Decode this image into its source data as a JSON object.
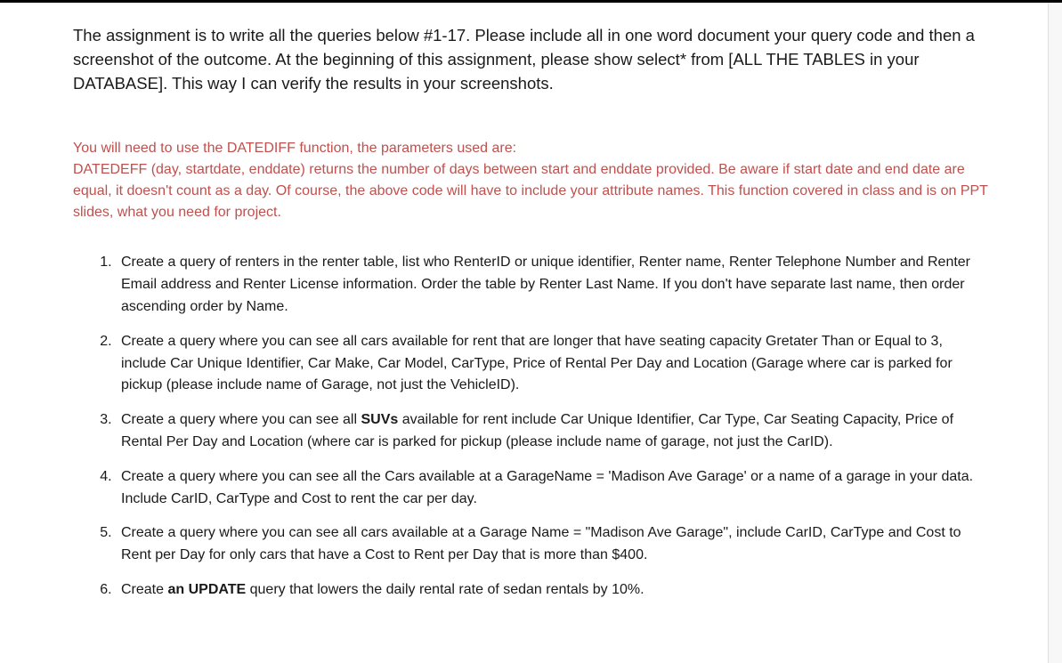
{
  "intro": "The assignment is to write all the queries below #1-17.  Please include all in one word document your query code and then a screenshot of the outcome.  At the beginning of this assignment, please show select* from [ALL THE TABLES in your DATABASE].  This way I can verify the results in your screenshots.",
  "hint": "You will need to use the DATEDIFF function, the parameters used are:\nDATEDEFF (day, startdate, enddate) returns the number of days between start and enddate provided.  Be aware if start date and end date are equal, it doesn't count as a day.  Of course, the above code will have to include your attribute names.  This function covered in class and is on PPT slides, what you need for project.",
  "items": [
    {
      "pre": "Create a query of renters in the renter table, list who RenterID or unique identifier, Renter name, Renter Telephone Number and Renter Email address and Renter License information.  Order the table by Renter Last Name.  If you don't have separate last name, then order ascending order by Name."
    },
    {
      "pre": "Create a query where you can see all cars available for rent that are longer that have seating capacity Gretater Than or Equal to 3, include Car Unique Identifier, Car Make, Car Model, CarType, Price of Rental Per Day and Location (Garage where car is parked for pickup (please include name of Garage, not just the VehicleID)."
    },
    {
      "pre": "Create a query where you can see all ",
      "bold": "SUVs",
      "post": " available for rent include Car Unique Identifier, Car Type, Car Seating Capacity, Price of Rental Per Day and Location (where car is parked for pickup (please include name of garage, not just the CarID)."
    },
    {
      "pre": "Create a query where you can see all the Cars available at a GarageName = 'Madison Ave Garage' or a name of a garage in your data.  Include CarID, CarType and Cost to rent the car per day."
    },
    {
      "pre": " Create a query where you can see all cars available at a Garage Name = \"Madison Ave Garage\", include CarID, CarType and Cost to Rent per Day for only cars that have a Cost to Rent per Day that is more than $400."
    },
    {
      "pre": "Create ",
      "bold": "an UPDATE",
      "post": " query that lowers the daily rental rate of sedan rentals by 10%."
    }
  ]
}
